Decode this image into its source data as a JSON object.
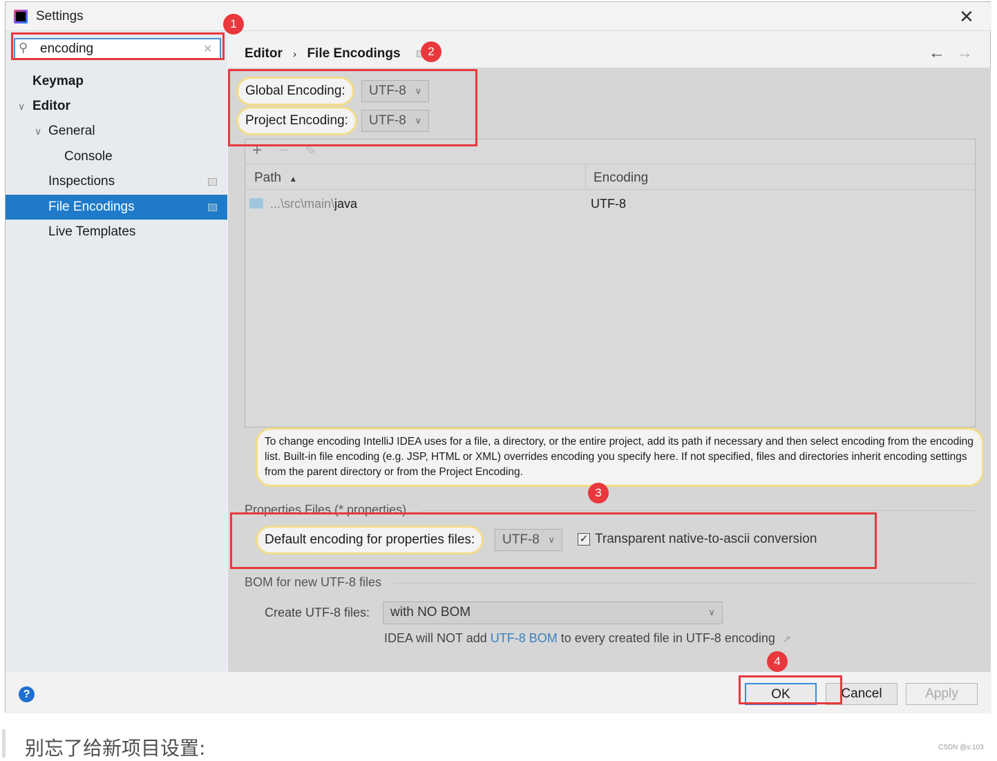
{
  "window": {
    "title": "Settings",
    "close_icon": "close-icon",
    "app_icon": "intellij-idea-icon"
  },
  "search": {
    "value": "encoding",
    "placeholder": ""
  },
  "sidebar": {
    "items": [
      {
        "label": "Keymap",
        "bold": true
      },
      {
        "label": "Editor",
        "bold": true,
        "expanded": true
      },
      {
        "label": "General",
        "expanded": true
      },
      {
        "label": "Console"
      },
      {
        "label": "Inspections"
      },
      {
        "label": "File Encodings",
        "selected": true
      },
      {
        "label": "Live Templates"
      }
    ]
  },
  "breadcrumb": {
    "parent": "Editor",
    "separator": "›",
    "current": "File Encodings"
  },
  "badges": [
    "1",
    "2",
    "3",
    "4"
  ],
  "encodings": {
    "global_label": "Global Encoding:",
    "global_value": "UTF-8",
    "project_label": "Project Encoding:",
    "project_value": "UTF-8"
  },
  "table": {
    "columns": [
      "Path",
      "Encoding"
    ],
    "rows": [
      {
        "path_prefix": "...\\src\\main\\",
        "path_leaf": "java",
        "encoding": "UTF-8"
      }
    ]
  },
  "help_text": "To change encoding IntelliJ IDEA uses for a file, a directory, or the entire project, add its path if necessary and then select encoding from the encoding list. Built-in file encoding (e.g. JSP, HTML or XML) overrides encoding you specify here. If not specified, files and directories inherit encoding settings from the parent directory or from the Project Encoding.",
  "properties": {
    "section": "Properties Files (*.properties)",
    "label": "Default encoding for properties files:",
    "value": "UTF-8",
    "checkbox_label": "Transparent native-to-ascii conversion",
    "checked": true
  },
  "bom": {
    "section": "BOM for new UTF-8 files",
    "label": "Create UTF-8 files:",
    "value": "with NO BOM",
    "note_before": "IDEA will NOT add ",
    "note_link": "UTF-8 BOM",
    "note_after": " to every created file in UTF-8 encoding"
  },
  "buttons": {
    "ok": "OK",
    "cancel": "Cancel",
    "apply": "Apply",
    "help": "?"
  },
  "page_below": {
    "text": "别忘了给新项目设置:",
    "watermark": "CSDN @s:103"
  },
  "colors": {
    "selection": "#1f7bc9",
    "annotation": "#e8383d",
    "link": "#3b7fc4"
  }
}
